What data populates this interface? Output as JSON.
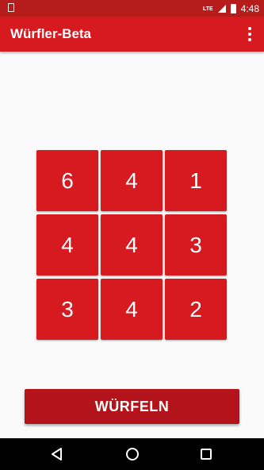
{
  "status_bar": {
    "network": "LTE",
    "time": "4:48"
  },
  "app_bar": {
    "title": "Würfler-Beta",
    "menu_icon": "more-vert-icon"
  },
  "dice": [
    {
      "value": "6"
    },
    {
      "value": "4"
    },
    {
      "value": "1"
    },
    {
      "value": "4"
    },
    {
      "value": "4"
    },
    {
      "value": "3"
    },
    {
      "value": "3"
    },
    {
      "value": "4"
    },
    {
      "value": "2"
    }
  ],
  "roll_button": {
    "label": "WÜRFELN"
  },
  "nav_bar": {
    "back_icon": "back-triangle-icon",
    "home_icon": "home-circle-icon",
    "recents_icon": "recents-square-icon"
  },
  "colors": {
    "status_bar": "#b71c1c",
    "primary": "#d71920",
    "button": "#b3141b",
    "background": "#fafafa"
  }
}
